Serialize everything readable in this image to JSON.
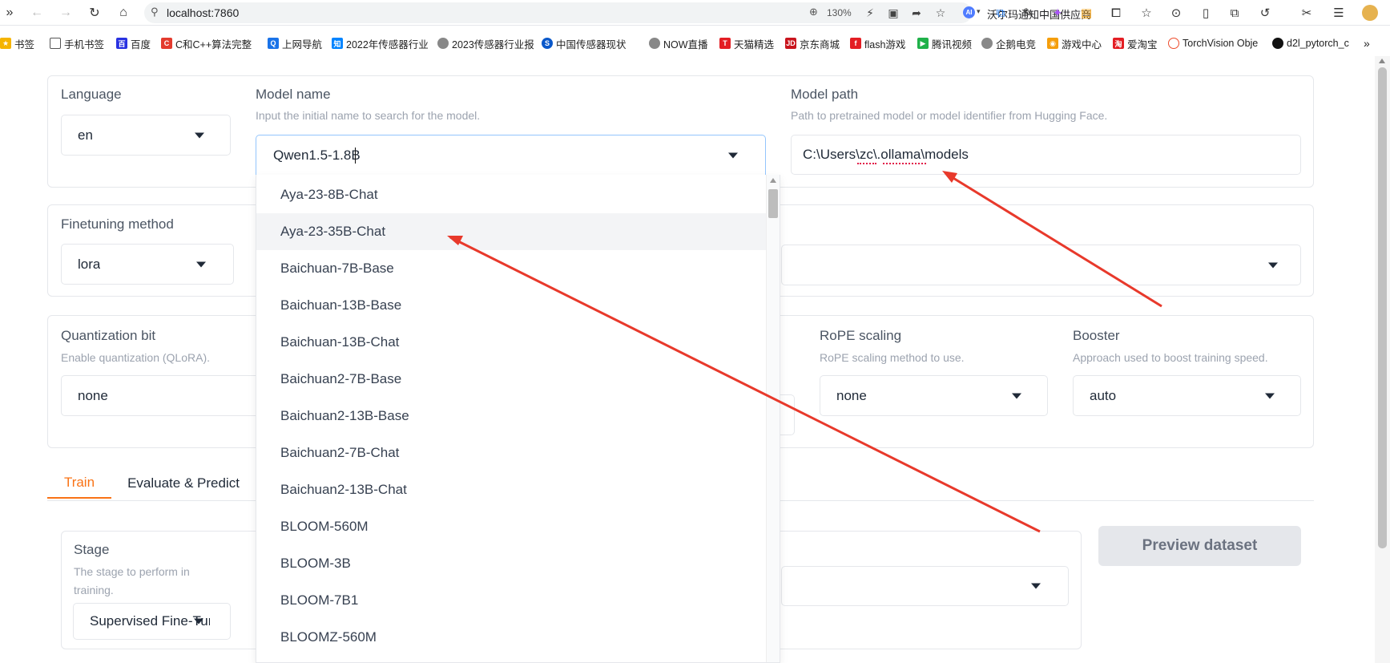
{
  "browser": {
    "url": "localhost:7860",
    "zoom": "130%",
    "ai_news": "沃尔玛通知中国供应商",
    "ai_badge": "AI"
  },
  "bookmarks": [
    {
      "label": "书签",
      "icon": "star-icon",
      "color": "#f5b400"
    },
    {
      "label": "手机书签",
      "icon": "phone-icon",
      "color": "#555555"
    },
    {
      "label": "百度",
      "icon": "baidu-icon",
      "color": "#2932e1"
    },
    {
      "label": "C和C++算法完整",
      "icon": "c-icon",
      "color": "#e33b2e"
    },
    {
      "label": "上网导航",
      "icon": "nav-icon",
      "color": "#1a73e8"
    },
    {
      "label": "2022年传感器行业",
      "icon": "zhihu-icon",
      "color": "#0084ff"
    },
    {
      "label": "2023传感器行业报",
      "icon": "globe-icon",
      "color": "#666666"
    },
    {
      "label": "中国传感器现状",
      "icon": "s-icon",
      "color": "#0a58ca"
    },
    {
      "label": "NOW直播",
      "icon": "globe-icon",
      "color": "#666666"
    },
    {
      "label": "天猫精选",
      "icon": "tmall-icon",
      "color": "#e31e24"
    },
    {
      "label": "京东商城",
      "icon": "jd-icon",
      "color": "#c9151e"
    },
    {
      "label": "flash游戏",
      "icon": "flash-icon",
      "color": "#e31e24"
    },
    {
      "label": "腾讯视频",
      "icon": "tencent-video-icon",
      "color": "#20b14a"
    },
    {
      "label": "企鹅电竞",
      "icon": "globe-icon",
      "color": "#666666"
    },
    {
      "label": "游戏中心",
      "icon": "game-icon",
      "color": "#f59e0b"
    },
    {
      "label": "爱淘宝",
      "icon": "taobao-icon",
      "color": "#e31e24"
    },
    {
      "label": "TorchVision Obje",
      "icon": "pytorch-icon",
      "color": "#ee4c2c"
    },
    {
      "label": "d2l_pytorch_c",
      "icon": "github-icon",
      "color": "#111111"
    }
  ],
  "top_config": {
    "language": {
      "label": "Language",
      "value": "en"
    },
    "model_name": {
      "label": "Model name",
      "info": "Input the initial name to search for the model.",
      "value": "Qwen1.5-1.8B"
    },
    "model_path": {
      "label": "Model path",
      "info": "Path to pretrained model or model identifier from Hugging Face.",
      "value": "C:\\Users\\zc\\.ollama\\models"
    }
  },
  "finetune": {
    "label": "Finetuning method",
    "value": "lora"
  },
  "quant": {
    "label": "Quantization bit",
    "info": "Enable quantization (QLoRA).",
    "value": "none"
  },
  "rope": {
    "label": "RoPE scaling",
    "info": "RoPE scaling method to use.",
    "value": "none"
  },
  "booster": {
    "label": "Booster",
    "info": "Approach used to boost training speed.",
    "value": "auto"
  },
  "tabs": [
    {
      "label": "Train",
      "active": true
    },
    {
      "label": "Evaluate & Predict",
      "active": false
    }
  ],
  "stage": {
    "label": "Stage",
    "info": "The stage to perform in training.",
    "value": "Supervised Fine-Tun"
  },
  "preview_button": "Preview dataset",
  "dropdown_options": [
    "Aya-23-8B-Chat",
    "Aya-23-35B-Chat",
    "Baichuan-7B-Base",
    "Baichuan-13B-Base",
    "Baichuan-13B-Chat",
    "Baichuan2-7B-Base",
    "Baichuan2-13B-Base",
    "Baichuan2-7B-Chat",
    "Baichuan2-13B-Chat",
    "BLOOM-560M",
    "BLOOM-3B",
    "BLOOM-7B1",
    "BLOOMZ-560M"
  ],
  "colors": {
    "accent": "#f97316",
    "arrow": "#e8392b"
  }
}
